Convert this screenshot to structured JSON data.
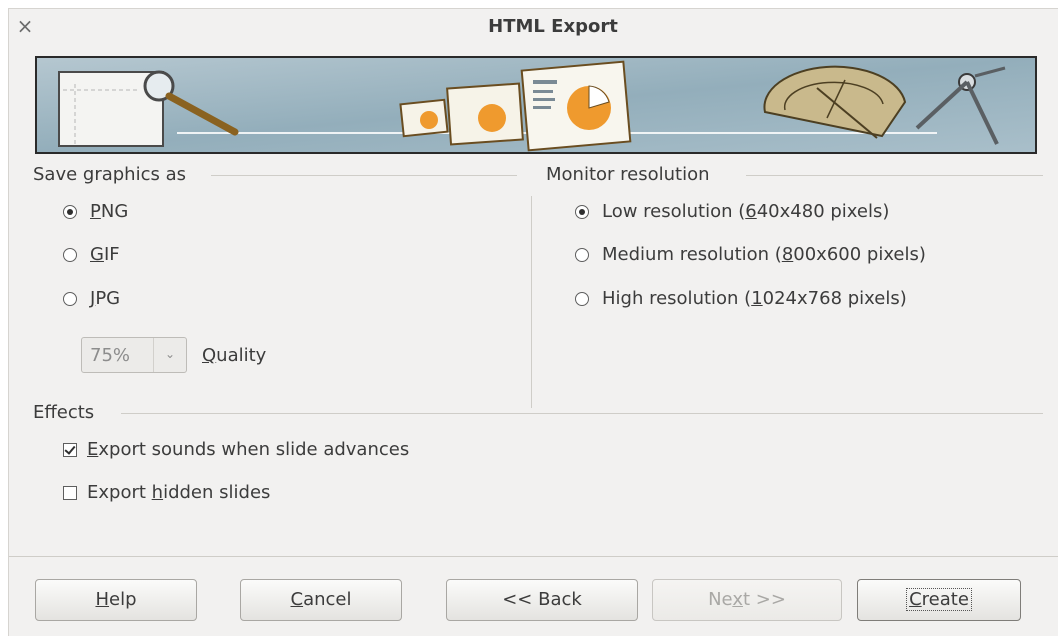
{
  "window": {
    "title": "HTML Export",
    "close_glyph": "×"
  },
  "banner": {
    "name": "wizard-banner-image"
  },
  "save_graphics": {
    "heading": "Save graphics as",
    "options": [
      {
        "pre": "",
        "ul": "P",
        "post": "NG",
        "selected": true
      },
      {
        "pre": "",
        "ul": "G",
        "post": "IF",
        "selected": false
      },
      {
        "pre": "",
        "ul": "J",
        "post": "PG",
        "selected": false
      }
    ],
    "quality": {
      "value": "75%",
      "label_pre": "",
      "label_ul": "Q",
      "label_post": "uality",
      "arrow": "⌄"
    }
  },
  "monitor_resolution": {
    "heading": "Monitor resolution",
    "options": [
      {
        "pre": "Low resolution (",
        "ul": "6",
        "post": "40x480 pixels)",
        "selected": true
      },
      {
        "pre": "Medium resolution (",
        "ul": "8",
        "post": "00x600 pixels)",
        "selected": false
      },
      {
        "pre": "High resolution (",
        "ul": "1",
        "post": "024x768 pixels)",
        "selected": false
      }
    ]
  },
  "effects": {
    "heading": "Effects",
    "options": [
      {
        "pre": "",
        "ul": "E",
        "post": "xport sounds when slide advances",
        "checked": true
      },
      {
        "pre": "Export ",
        "ul": "h",
        "post": "idden slides",
        "checked": false
      }
    ]
  },
  "buttons": {
    "help": {
      "pre": "",
      "ul": "H",
      "post": "elp"
    },
    "cancel": {
      "pre": "",
      "ul": "C",
      "post": "ancel"
    },
    "back": {
      "label": "<< Back"
    },
    "next": {
      "pre": "Ne",
      "ul": "x",
      "post": "t >>"
    },
    "create": {
      "pre": "",
      "ul": "C",
      "post": "reate"
    }
  }
}
